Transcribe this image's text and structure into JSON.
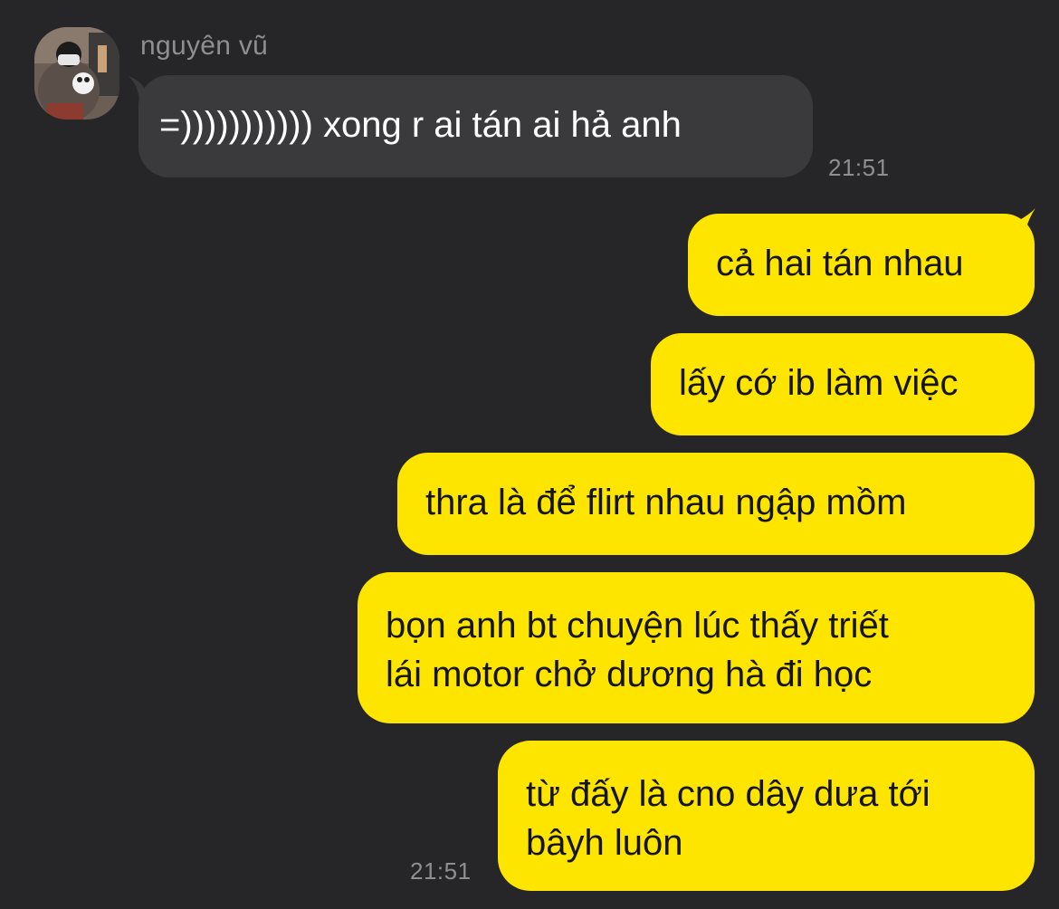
{
  "colors": {
    "background": "#262628",
    "incoming_bubble": "#3a3a3c",
    "outgoing_bubble": "#fde500",
    "incoming_text": "#ffffff",
    "outgoing_text": "#151515",
    "meta_text": "#8e8e93"
  },
  "sender": {
    "name": "nguyên vũ",
    "avatar_icon": "profile-photo-avatar"
  },
  "messages": {
    "incoming": [
      {
        "text": "=))))))))))) xong r ai tán ai hả anh",
        "time": "21:51"
      }
    ],
    "outgoing": [
      {
        "text": "cả hai tán nhau"
      },
      {
        "text": "lấy cớ ib làm việc"
      },
      {
        "text": "thra là để flirt nhau ngập mồm"
      },
      {
        "line1": "bọn anh bt chuyện lúc thấy triết",
        "line2": "lái motor chở dương hà đi học"
      },
      {
        "line1": "từ đấy là cno dây dưa tới",
        "line2": "bâyh luôn"
      }
    ],
    "outgoing_time": "21:51"
  }
}
